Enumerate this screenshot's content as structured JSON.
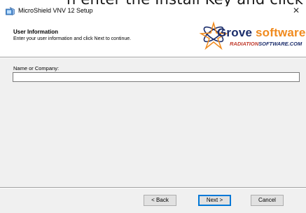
{
  "caption": {
    "text": "n enter the Install Key and click N"
  },
  "window": {
    "title": "MicroShield VNV 12 Setup",
    "close_glyph": "✕",
    "icon": "installer-app-icon"
  },
  "header": {
    "title": "User Information",
    "subtitle": "Enter your user information and click Next to continue.",
    "logo": {
      "word_grove": "Grove",
      "word_software": "software",
      "sub_radiation": "RADIATION",
      "sub_software": "SOFTWARE.COM",
      "colors": {
        "navy": "#1b2d6b",
        "orange": "#f08a1d",
        "red": "#c0392b"
      }
    }
  },
  "form": {
    "name_label": "Name or Company:",
    "name_value": ""
  },
  "buttons": {
    "back": "< Back",
    "next": "Next >",
    "cancel": "Cancel"
  }
}
